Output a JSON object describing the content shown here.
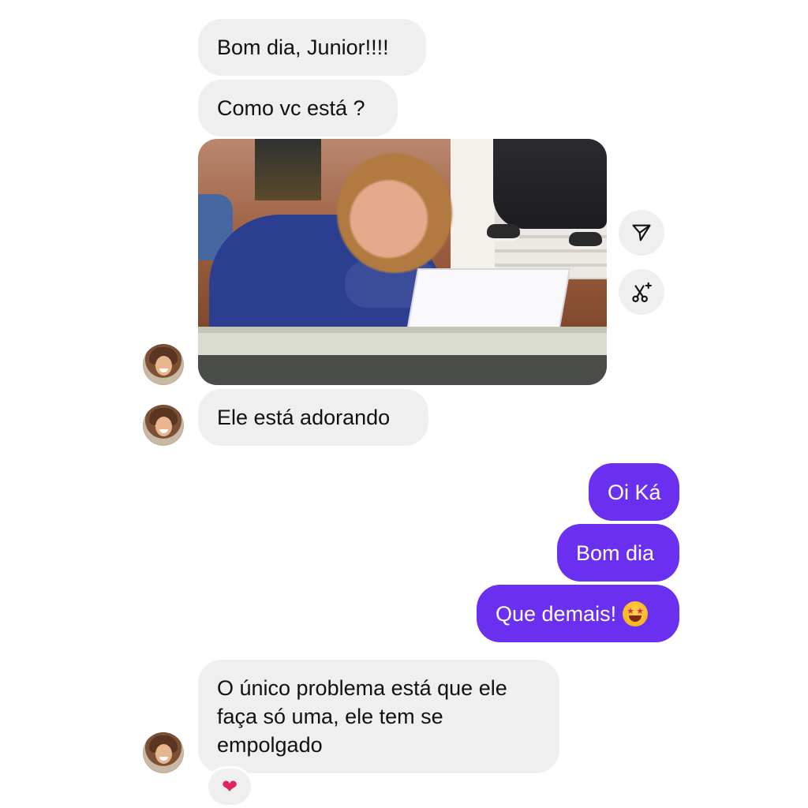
{
  "colors": {
    "incoming_bg": "#efefef",
    "outgoing_bg": "#6b2ff0",
    "text_dark": "#111111",
    "text_light": "#ffffff",
    "heart": "#e0245e"
  },
  "messages": [
    {
      "id": "m1",
      "side": "incoming",
      "text": "Bom dia, Junior!!!!"
    },
    {
      "id": "m2",
      "side": "incoming",
      "text": "Como vc está ?"
    },
    {
      "id": "m3",
      "side": "incoming",
      "type": "photo"
    },
    {
      "id": "m4",
      "side": "incoming",
      "text": "Ele está adorando"
    },
    {
      "id": "m5",
      "side": "outgoing",
      "text": "Oi Ká"
    },
    {
      "id": "m6",
      "side": "outgoing",
      "text": "Bom dia"
    },
    {
      "id": "m7",
      "side": "outgoing",
      "text": "Que demais!",
      "emoji": "star-struck-emoji"
    },
    {
      "id": "m8",
      "side": "incoming",
      "lines": [
        "O único problema está que ele",
        "faça só uma, ele tem se",
        "empolgado"
      ],
      "reaction": "red-heart"
    }
  ],
  "photo_actions": [
    {
      "icon": "share-send-icon"
    },
    {
      "icon": "ai-edit-scissors-icon"
    }
  ]
}
